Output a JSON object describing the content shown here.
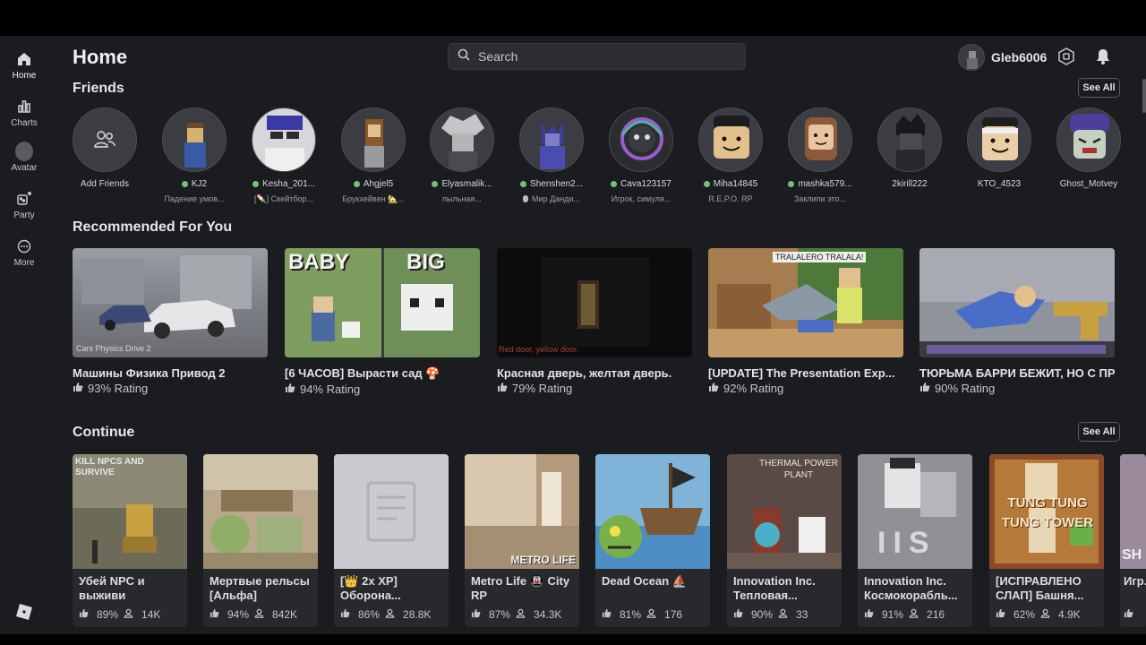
{
  "sidebar": {
    "items": [
      {
        "label": "Home",
        "icon": "home-icon"
      },
      {
        "label": "Charts",
        "icon": "charts-icon"
      },
      {
        "label": "Avatar",
        "icon": "avatar-icon"
      },
      {
        "label": "Party",
        "icon": "party-icon"
      },
      {
        "label": "More",
        "icon": "more-icon"
      }
    ]
  },
  "header": {
    "title": "Home",
    "search_placeholder": "Search",
    "username": "Gleb6006"
  },
  "friends": {
    "title": "Friends",
    "see_all": "See All",
    "items": [
      {
        "name": "Add Friends",
        "status": "",
        "online": false
      },
      {
        "name": "KJ2",
        "status": "Падение умов...",
        "online": true
      },
      {
        "name": "Kesha_201...",
        "status": "[🍡] Скейтбор...",
        "online": true
      },
      {
        "name": "Ahgjel5",
        "status": "Брукхейвен 🏡...",
        "online": true
      },
      {
        "name": "Elyasmalik...",
        "status": "пыльная...",
        "online": true
      },
      {
        "name": "Shenshen2...",
        "status": "Мир Данди...",
        "online": true
      },
      {
        "name": "Cava123157",
        "status": "Игрок, симуля...",
        "online": true
      },
      {
        "name": "Miha14845",
        "status": "R.E.P.O. RP",
        "online": true
      },
      {
        "name": "mashka579...",
        "status": "Заклипи это...",
        "online": true
      },
      {
        "name": "2kirill222",
        "status": "",
        "online": false
      },
      {
        "name": "KTO_4523",
        "status": "",
        "online": false
      },
      {
        "name": "Ghost_Motvey",
        "status": "",
        "online": false
      }
    ]
  },
  "recommended": {
    "title": "Recommended For You",
    "items": [
      {
        "title": "Машины Физика Привод 2",
        "rating": "93% Rating",
        "thumb_caption": "Cars Physics Drive 2"
      },
      {
        "title": "[6 ЧАСОВ] Вырасти сад 🍄",
        "rating": "94% Rating",
        "thumb_caption_left": "BABY",
        "thumb_caption_right": "BIG"
      },
      {
        "title": "Красная дверь, желтая дверь.",
        "rating": "79% Rating",
        "thumb_caption": "Red door, yellow door."
      },
      {
        "title": "[UPDATE] The Presentation Exp...",
        "rating": "92% Rating",
        "thumb_caption": "TRALALERO TRALALA!"
      },
      {
        "title": "ТЮРЬМА БАРРИ БЕЖИТ, НО С ПРЕ...",
        "rating": "90% Rating"
      }
    ]
  },
  "continue": {
    "title": "Continue",
    "see_all": "See All",
    "items": [
      {
        "title": "Убей NPC и выживи",
        "rating": "89%",
        "players": "14K",
        "thumb_caption": "KILL NPCS AND SURVIVE"
      },
      {
        "title": "Мертвые рельсы [Альфа]",
        "rating": "94%",
        "players": "842K"
      },
      {
        "title": "[👑 2x XP] Оборона...",
        "rating": "86%",
        "players": "28.8K"
      },
      {
        "title": "Metro Life 🚇 City RP",
        "rating": "87%",
        "players": "34.3K",
        "thumb_caption": "METRO LIFE"
      },
      {
        "title": "Dead Ocean ⛵",
        "rating": "81%",
        "players": "176"
      },
      {
        "title": "Innovation Inc. Тепловая...",
        "rating": "90%",
        "players": "33",
        "thumb_caption": "THERMAL POWER PLANT"
      },
      {
        "title": "Innovation Inc. Космокорабль...",
        "rating": "91%",
        "players": "216",
        "thumb_caption": "IIS"
      },
      {
        "title": "[ИСПРАВЛЕНО СЛАП] Башня...",
        "rating": "62%",
        "players": "4.9K",
        "thumb_caption": "TUNG TUNG TUNG TOWER"
      },
      {
        "title": "Игр... кре...",
        "rating": "",
        "players": "",
        "thumb_caption": "SH"
      }
    ]
  },
  "colors": {
    "background": "#1b1c1f",
    "card": "#28292d",
    "online": "#76c176"
  }
}
